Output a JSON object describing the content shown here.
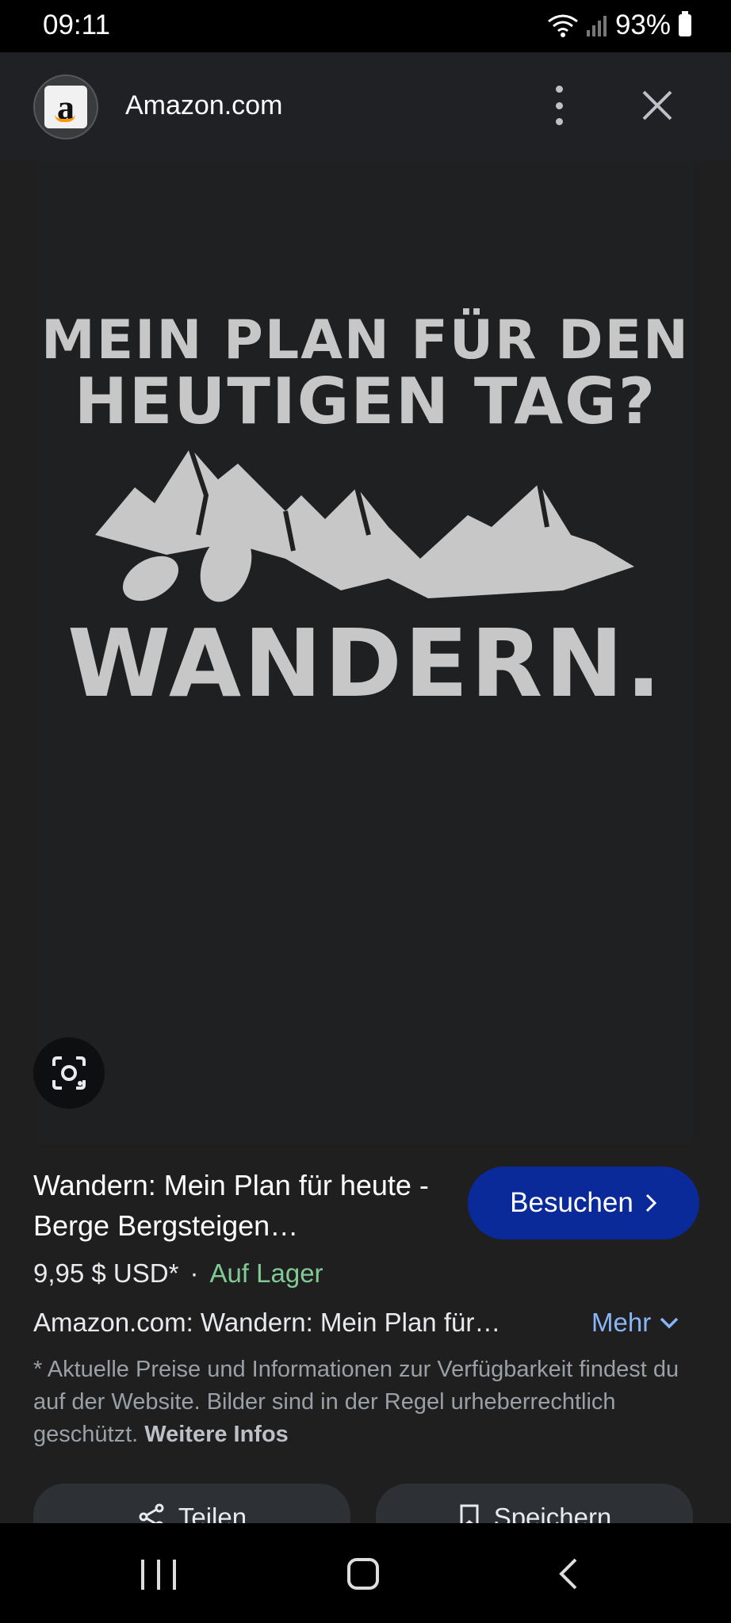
{
  "status_bar": {
    "time": "09:11",
    "battery": "93%"
  },
  "header": {
    "site_name": "Amazon.com",
    "favicon_letter": "a"
  },
  "image": {
    "line1": "MEIN PLAN FÜR DEN",
    "line2": "HEUTIGEN TAG?",
    "line3": "WANDERN."
  },
  "product": {
    "title": "Wandern: Mein Plan für heute - Berge Bergsteigen…",
    "visit_label": "Besuchen",
    "price": "9,95 $ USD*",
    "separator": "·",
    "availability": "Auf Lager",
    "description": "Amazon.com: Wandern: Mein Plan für…",
    "more_label": "Mehr",
    "disclaimer": "* Aktuelle Preise und Informationen zur Verfügbarkeit findest du auf der Website. Bilder sind in der Regel urheberrechtlich geschützt.",
    "disclaimer_link": "Weitere Infos"
  },
  "actions": {
    "share_label": "Teilen",
    "save_label": "Speichern"
  },
  "colors": {
    "visit_button": "#0b2a9a",
    "in_stock": "#81c995",
    "link": "#8ab4f8"
  }
}
